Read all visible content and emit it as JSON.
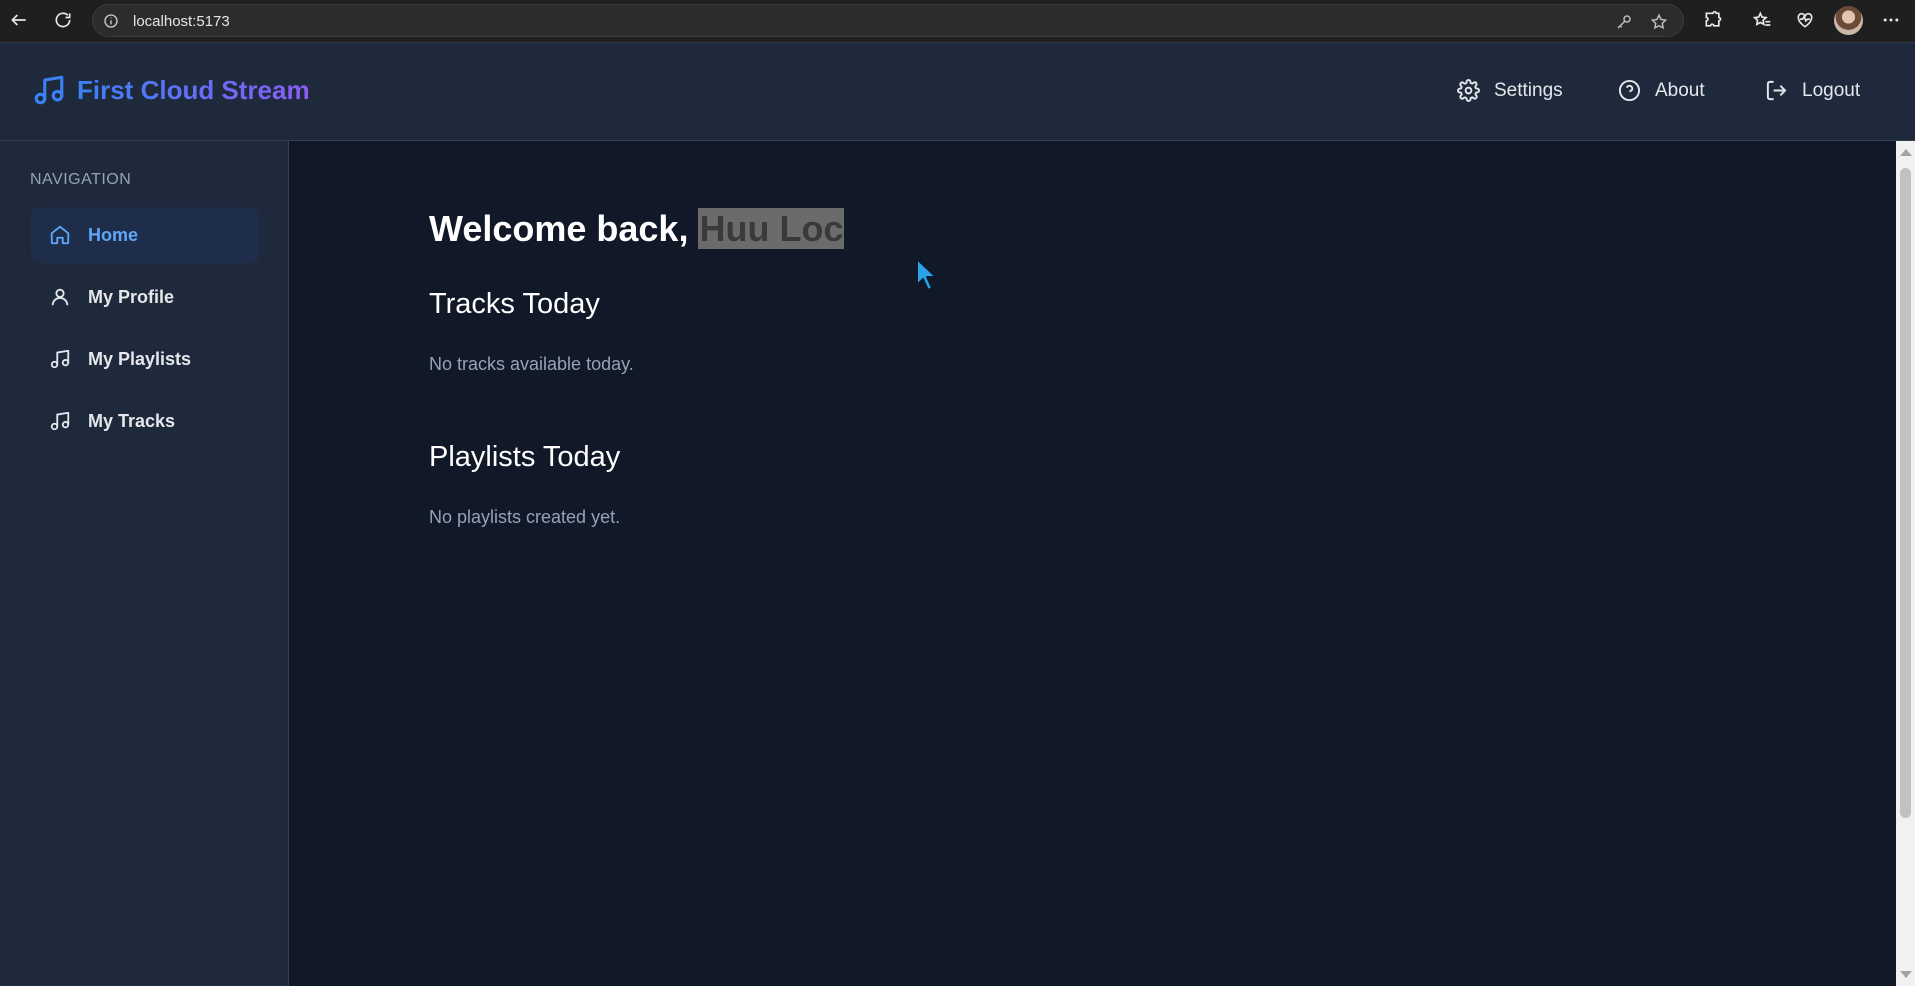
{
  "browser": {
    "url": "localhost:5173"
  },
  "app": {
    "brand": "First Cloud Stream",
    "top_nav": [
      {
        "label": "Settings",
        "icon": "gear-icon"
      },
      {
        "label": "About",
        "icon": "help-circle-icon"
      },
      {
        "label": "Logout",
        "icon": "logout-icon"
      }
    ]
  },
  "sidebar": {
    "heading": "NAVIGATION",
    "items": [
      {
        "label": "Home",
        "icon": "home-icon",
        "active": true
      },
      {
        "label": "My Profile",
        "icon": "user-icon"
      },
      {
        "label": "My Playlists",
        "icon": "music-note-icon"
      },
      {
        "label": "My Tracks",
        "icon": "music-note-icon"
      }
    ]
  },
  "main": {
    "welcome_prefix": "Welcome back, ",
    "username": "Huu Loc",
    "tracks_title": "Tracks Today",
    "tracks_empty": "No tracks available today.",
    "playlists_title": "Playlists Today",
    "playlists_empty": "No playlists created yet."
  },
  "colors": {
    "accent": "#3b82f6",
    "brand_gradient_end": "#8b5cf6",
    "sidebar_bg": "#1e293b",
    "main_bg": "#111827",
    "active_text": "#60a5fa"
  }
}
